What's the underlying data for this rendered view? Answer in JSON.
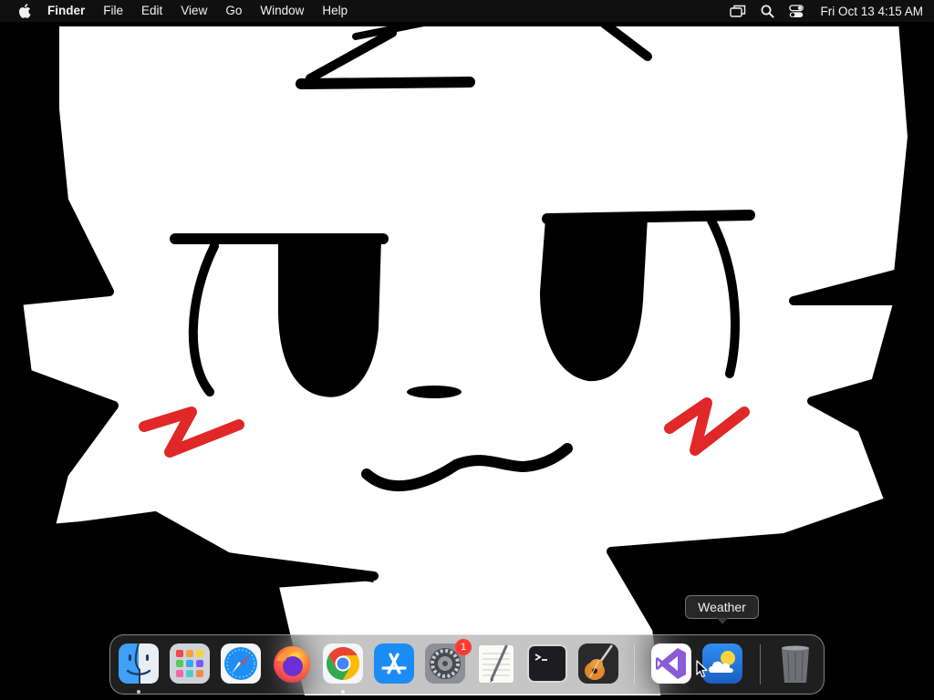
{
  "menubar": {
    "apple_icon": "apple-logo-icon",
    "app_name": "Finder",
    "menus": [
      "File",
      "Edit",
      "View",
      "Go",
      "Window",
      "Help"
    ],
    "status_icons": [
      "screen-mirroring-icon",
      "spotlight-search-icon",
      "control-center-icon"
    ],
    "clock": "Fri Oct 13  4:15 AM"
  },
  "tooltip": {
    "text": "Weather"
  },
  "dock": {
    "apps": [
      {
        "name": "Finder",
        "icon": "finder-icon",
        "running": true
      },
      {
        "name": "Launchpad",
        "icon": "launchpad-icon",
        "running": false
      },
      {
        "name": "Safari",
        "icon": "safari-icon",
        "running": false
      },
      {
        "name": "Firefox",
        "icon": "firefox-icon",
        "running": false
      },
      {
        "name": "Google Chrome",
        "icon": "chrome-icon",
        "running": true
      },
      {
        "name": "App Store",
        "icon": "app-store-icon",
        "running": false
      },
      {
        "name": "System Settings",
        "icon": "system-settings-icon",
        "running": false,
        "badge": "1"
      },
      {
        "name": "TextEdit",
        "icon": "textedit-icon",
        "running": false
      },
      {
        "name": "Terminal",
        "icon": "terminal-icon",
        "running": false
      },
      {
        "name": "GarageBand",
        "icon": "garageband-icon",
        "running": false
      }
    ],
    "recent_apps": [
      {
        "name": "Visual Studio",
        "icon": "visual-studio-icon",
        "running": false
      },
      {
        "name": "Weather",
        "icon": "weather-icon",
        "running": false
      }
    ],
    "trash": {
      "name": "Trash",
      "icon": "trash-icon"
    }
  },
  "colors": {
    "menubar_bg": "#141414",
    "wallpaper_blush": "#e02828",
    "badge": "#ff3b30"
  }
}
